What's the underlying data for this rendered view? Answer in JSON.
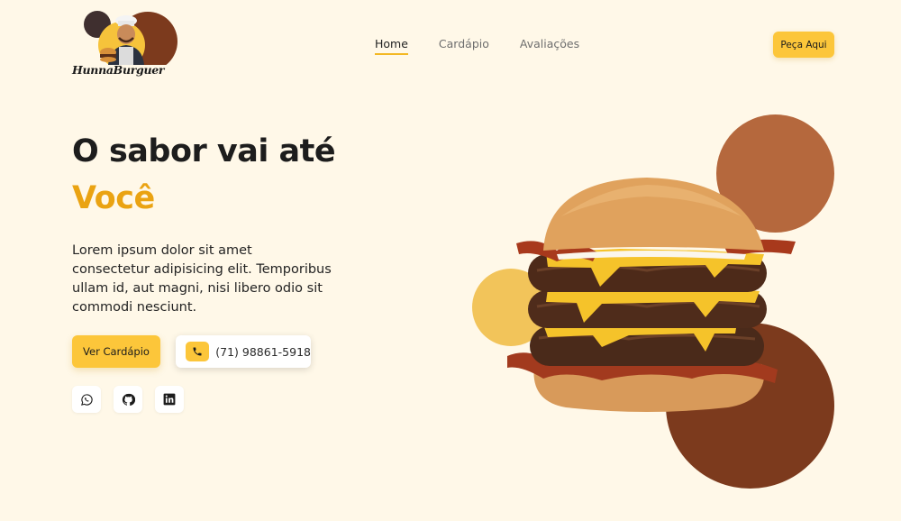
{
  "brand": {
    "name": "HunnaBurguer"
  },
  "nav": {
    "items": [
      {
        "label": "Home",
        "active": true
      },
      {
        "label": "Cardápio",
        "active": false
      },
      {
        "label": "Avaliações",
        "active": false
      }
    ],
    "cta_label": "Peça Aqui"
  },
  "hero": {
    "title": "O sabor vai até",
    "highlight": "Você",
    "description": "Lorem ipsum dolor sit amet consectetur adipisicing elit. Temporibus ullam id, aut magni, nisi libero odio sit commodi nesciunt.",
    "menu_button_label": "Ver Cardápio",
    "phone": "(71) 98861-5918"
  },
  "socials": [
    {
      "icon": "whatsapp-icon"
    },
    {
      "icon": "github-icon"
    },
    {
      "icon": "linkedin-icon"
    }
  ],
  "colors": {
    "background": "#fff8e8",
    "accent": "#fcc63a",
    "highlight_text": "#eaa312",
    "circle_orange": "#b5683d",
    "circle_yellow": "#f2c45a",
    "circle_brown": "#7c3a1d"
  }
}
